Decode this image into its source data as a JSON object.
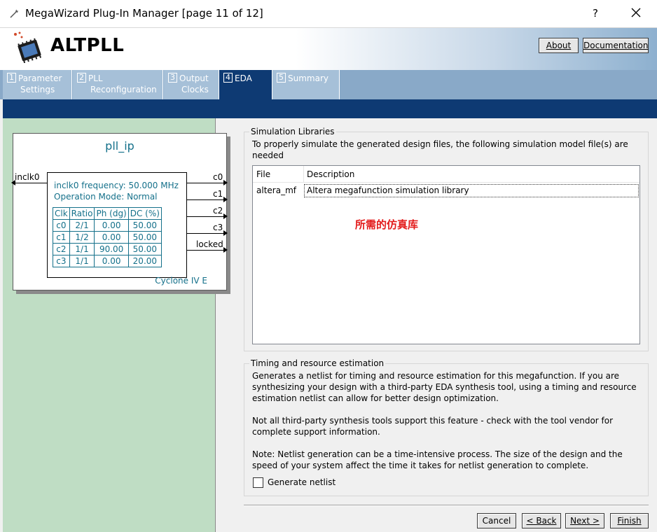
{
  "window": {
    "title": "MegaWizard Plug-In Manager [page 11 of 12]",
    "help": "?"
  },
  "header": {
    "logo_text": "ALTPLL",
    "about_label": "About",
    "documentation_label": "Documentation"
  },
  "tabs": [
    {
      "num": "1",
      "line1": "Parameter",
      "line2": "Settings",
      "active": false
    },
    {
      "num": "2",
      "line1": "PLL",
      "line2": "Reconfiguration",
      "active": false
    },
    {
      "num": "3",
      "line1": "Output",
      "line2": "Clocks",
      "active": false
    },
    {
      "num": "4",
      "line1": "EDA",
      "line2": "",
      "active": true
    },
    {
      "num": "5",
      "line1": "Summary",
      "line2": "",
      "active": false
    }
  ],
  "symbol": {
    "name": "pll_ip",
    "input_port": "inclk0",
    "output_ports": [
      "c0",
      "c1",
      "c2",
      "c3",
      "locked"
    ],
    "info_line1": "inclk0 frequency: 50.000 MHz",
    "info_line2": "Operation Mode: Normal",
    "table_headers": [
      "Clk",
      "Ratio",
      "Ph (dg)",
      "DC (%)"
    ],
    "table_rows": [
      [
        "c0",
        "2/1",
        "0.00",
        "50.00"
      ],
      [
        "c1",
        "1/2",
        "0.00",
        "50.00"
      ],
      [
        "c2",
        "1/1",
        "90.00",
        "50.00"
      ],
      [
        "c3",
        "1/1",
        "0.00",
        "20.00"
      ]
    ],
    "device": "Cyclone IV E"
  },
  "simulation": {
    "title": "Simulation Libraries",
    "description": "To properly simulate the generated design files, the following simulation model file(s) are needed",
    "col_file": "File",
    "col_description": "Description",
    "rows": [
      {
        "file": "altera_mf",
        "description": "Altera megafunction simulation library"
      }
    ],
    "annotation": "所需的仿真库"
  },
  "timing": {
    "title": "Timing and resource estimation",
    "para1": "Generates a netlist for timing and resource estimation for this megafunction. If you are synthesizing your design with a third-party EDA synthesis tool, using a timing and resource estimation netlist can allow for better design optimization.",
    "para2": "Not all third-party synthesis tools support this feature - check with the tool vendor for complete support information.",
    "para3": "Note: Netlist generation can be a time-intensive process. The size of the design and the speed of your system affect the time it takes for netlist generation to complete.",
    "checkbox_label": "Generate netlist",
    "checkbox_checked": false
  },
  "footer": {
    "cancel": "Cancel",
    "back": "< Back",
    "next": "Next >",
    "finish": "Finish"
  },
  "colors": {
    "navy": "#0e3a73",
    "tab": "#a6c0d8",
    "left_panel": "#bfddc4",
    "teal_text": "#14708a",
    "annotation": "#e31b1b"
  }
}
